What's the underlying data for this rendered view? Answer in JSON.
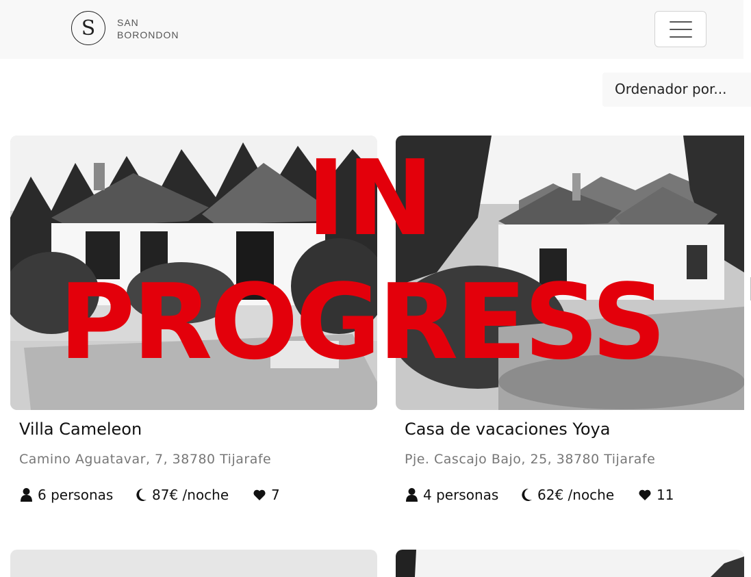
{
  "brand": {
    "initial": "S",
    "line1": "SAN",
    "line2": "BORONDON"
  },
  "sort": {
    "placeholder": "Ordenador por..."
  },
  "overlay": {
    "line1": "IN",
    "line2": "PROGRESS"
  },
  "listings": [
    {
      "title": "Villa Cameleon",
      "address": "Camino Aguatavar, 7, 38780 Tijarafe",
      "guests": "6 personas",
      "price": "87€ /noche",
      "likes": "7"
    },
    {
      "title": "Casa de vacaciones Yoya",
      "address": "Pje. Cascajo Bajo, 25, 38780 Tijarafe",
      "guests": "4 personas",
      "price": "62€ /noche",
      "likes": "11"
    }
  ],
  "icons": {
    "guests": "user-icon",
    "price": "moon-icon",
    "likes": "heart-icon",
    "menu": "hamburger-menu-icon"
  },
  "colors": {
    "overlay": "#e3000b",
    "navbar": "#f8f8f8",
    "address": "#777777"
  }
}
